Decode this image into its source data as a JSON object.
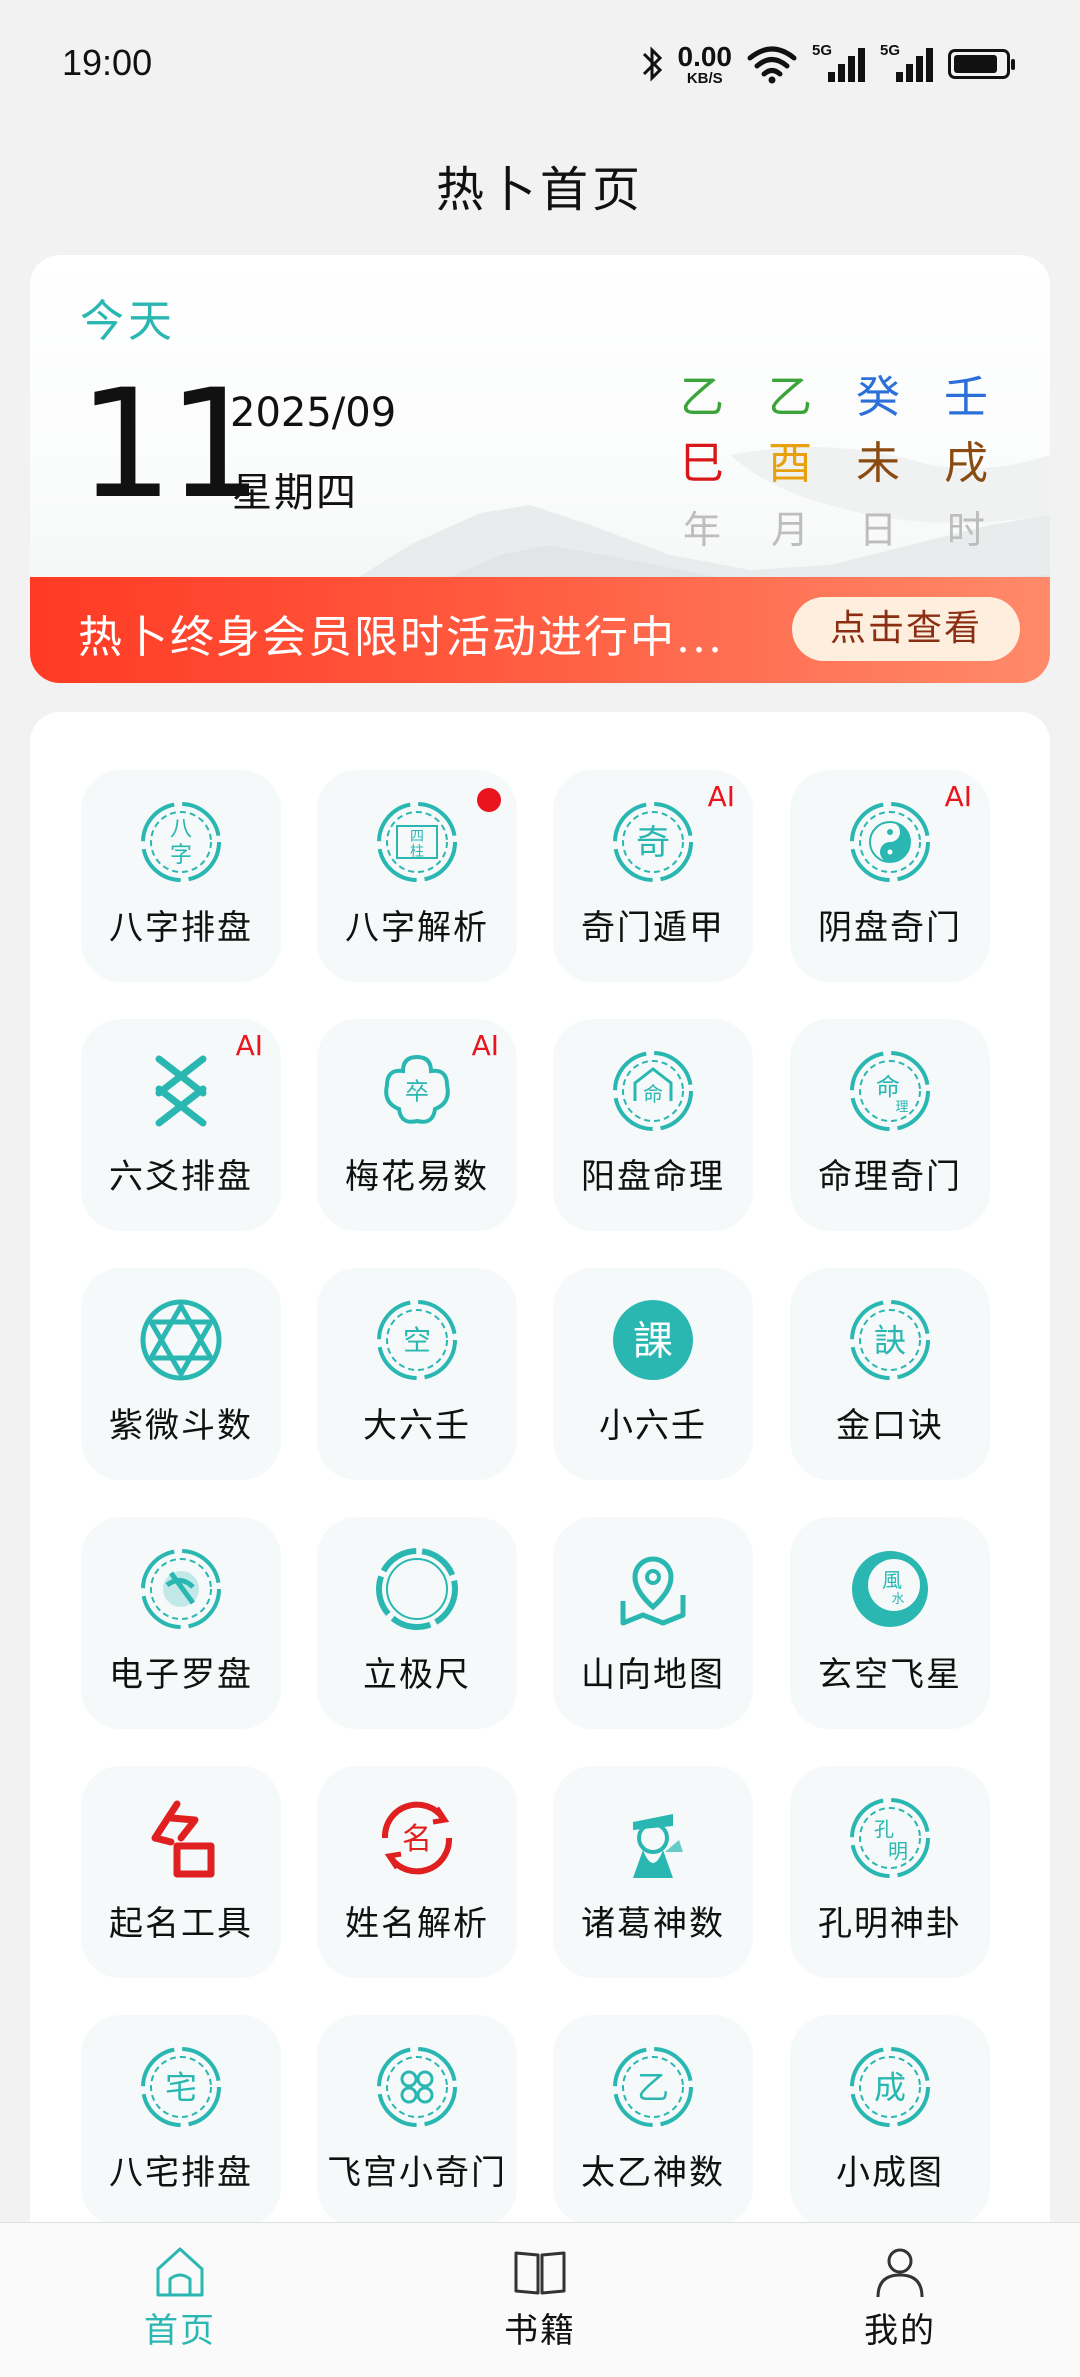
{
  "status": {
    "time": "19:00",
    "net_speed_value": "0.00",
    "net_speed_unit": "KB/S",
    "signal1_label": "5G",
    "signal2_label": "5G",
    "battery_level": 0.85
  },
  "page_title": "热卜首页",
  "date_card": {
    "today_label": "今天",
    "day": "11",
    "year_month": "2025/09",
    "weekday": "星期四",
    "ganzhi": [
      {
        "stem": "乙",
        "stem_color": "#3aa33a",
        "branch": "巳",
        "branch_color": "#d81818",
        "label": "年"
      },
      {
        "stem": "乙",
        "stem_color": "#3aa33a",
        "branch": "酉",
        "branch_color": "#e8a10e",
        "label": "月"
      },
      {
        "stem": "癸",
        "stem_color": "#2b6fd9",
        "branch": "未",
        "branch_color": "#8a4b12",
        "label": "日"
      },
      {
        "stem": "壬",
        "stem_color": "#2b6fd9",
        "branch": "戌",
        "branch_color": "#8a4b12",
        "label": "时"
      }
    ]
  },
  "promo": {
    "text": "热卜终身会员限时活动进行中...",
    "button_label": "点击查看"
  },
  "colors": {
    "accent": "#2ab7b2",
    "badge_red": "#e8141e",
    "promo_red": "#ff3a24"
  },
  "tools": [
    {
      "label": "八字排盘",
      "icon": "bazi-paipan-icon",
      "badge": ""
    },
    {
      "label": "八字解析",
      "icon": "sizhu-icon",
      "badge": "dot"
    },
    {
      "label": "奇门遁甲",
      "icon": "qimen-icon",
      "badge": "AI"
    },
    {
      "label": "阴盘奇门",
      "icon": "yinyang-icon",
      "badge": "AI"
    },
    {
      "label": "六爻排盘",
      "icon": "liuyao-icon",
      "badge": "AI"
    },
    {
      "label": "梅花易数",
      "icon": "plum-blossom-icon",
      "badge": "AI"
    },
    {
      "label": "阳盘命理",
      "icon": "mingli-icon",
      "badge": ""
    },
    {
      "label": "命理奇门",
      "icon": "mingli-qimen-icon",
      "badge": ""
    },
    {
      "label": "紫微斗数",
      "icon": "star-of-david-icon",
      "badge": ""
    },
    {
      "label": "大六壬",
      "icon": "da-liuren-icon",
      "badge": ""
    },
    {
      "label": "小六壬",
      "icon": "ke-icon",
      "badge": ""
    },
    {
      "label": "金口诀",
      "icon": "jue-icon",
      "badge": ""
    },
    {
      "label": "电子罗盘",
      "icon": "compass-icon",
      "badge": ""
    },
    {
      "label": "立极尺",
      "icon": "ring-icon",
      "badge": ""
    },
    {
      "label": "山向地图",
      "icon": "map-pin-icon",
      "badge": ""
    },
    {
      "label": "玄空飞星",
      "icon": "fengshui-icon",
      "badge": ""
    },
    {
      "label": "起名工具",
      "icon": "naming-icon",
      "badge": ""
    },
    {
      "label": "姓名解析",
      "icon": "name-analysis-icon",
      "badge": ""
    },
    {
      "label": "诸葛神数",
      "icon": "zhuge-portrait-icon",
      "badge": ""
    },
    {
      "label": "孔明神卦",
      "icon": "kongming-icon",
      "badge": ""
    },
    {
      "label": "八宅排盘",
      "icon": "bazhai-icon",
      "badge": ""
    },
    {
      "label": "飞宫小奇门",
      "icon": "feigong-icon",
      "badge": ""
    },
    {
      "label": "太乙神数",
      "icon": "taiyi-icon",
      "badge": ""
    },
    {
      "label": "小成图",
      "icon": "xiaocheng-icon",
      "badge": ""
    }
  ],
  "tabs": [
    {
      "label": "首页",
      "icon": "home-icon",
      "active": true
    },
    {
      "label": "书籍",
      "icon": "book-icon",
      "active": false
    },
    {
      "label": "我的",
      "icon": "person-icon",
      "active": false
    }
  ]
}
